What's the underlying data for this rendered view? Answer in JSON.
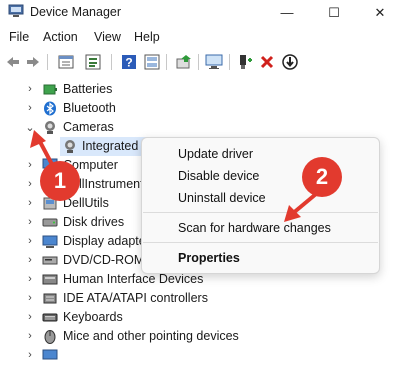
{
  "window": {
    "title": "Device Manager",
    "minimize_glyph": "—",
    "maximize_glyph": "☐",
    "close_glyph": "✕"
  },
  "menu": {
    "items": [
      "File",
      "Action",
      "View",
      "Help"
    ]
  },
  "toolbar": {
    "icons": [
      "back-arrow-icon",
      "forward-arrow-icon",
      "properties-icon",
      "device-list-icon",
      "help-icon",
      "device-view-icon",
      "update-driver-icon",
      "monitor-icon",
      "add-driver-icon",
      "uninstall-icon",
      "download-icon"
    ]
  },
  "tree": {
    "items": [
      {
        "label": "Batteries",
        "expanded": false,
        "icon": "battery-icon"
      },
      {
        "label": "Bluetooth",
        "expanded": false,
        "icon": "bluetooth-icon"
      },
      {
        "label": "Cameras",
        "expanded": true,
        "icon": "camera-icon"
      },
      {
        "label": "Integrated W",
        "child": true,
        "selected": true,
        "icon": "webcam-icon"
      },
      {
        "label": "Computer",
        "expanded": false,
        "icon": "computer-icon"
      },
      {
        "label": "DellInstrument",
        "expanded": false,
        "icon": "instrument-icon"
      },
      {
        "label": "DellUtils",
        "expanded": false,
        "icon": "utils-icon"
      },
      {
        "label": "Disk drives",
        "expanded": false,
        "icon": "disk-drive-icon"
      },
      {
        "label": "Display adapte",
        "expanded": false,
        "icon": "display-adapter-icon"
      },
      {
        "label": "DVD/CD-ROM",
        "expanded": false,
        "icon": "dvd-icon"
      },
      {
        "label": "Human Interface Devices",
        "expanded": false,
        "icon": "hid-icon"
      },
      {
        "label": "IDE ATA/ATAPI controllers",
        "expanded": false,
        "icon": "ide-icon"
      },
      {
        "label": "Keyboards",
        "expanded": false,
        "icon": "keyboard-icon"
      },
      {
        "label": "Mice and other pointing devices",
        "expanded": false,
        "icon": "mouse-icon"
      }
    ]
  },
  "context_menu": {
    "update_driver": "Update driver",
    "disable_device": "Disable device",
    "uninstall_device": "Uninstall device",
    "scan_hardware": "Scan for hardware changes",
    "properties": "Properties"
  },
  "annotations": {
    "badge1": "1",
    "badge2": "2",
    "color": "#e23a2e"
  }
}
